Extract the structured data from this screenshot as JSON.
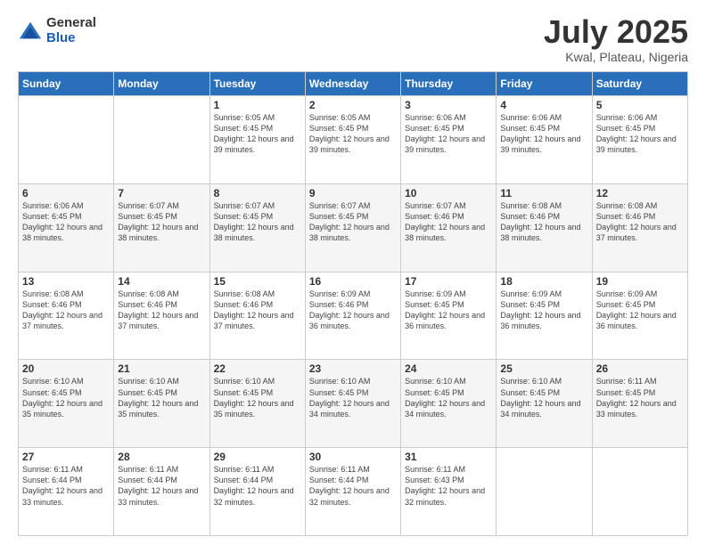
{
  "logo": {
    "general": "General",
    "blue": "Blue"
  },
  "header": {
    "month": "July 2025",
    "location": "Kwal, Plateau, Nigeria"
  },
  "days_of_week": [
    "Sunday",
    "Monday",
    "Tuesday",
    "Wednesday",
    "Thursday",
    "Friday",
    "Saturday"
  ],
  "weeks": [
    [
      {
        "day": "",
        "sunrise": "",
        "sunset": "",
        "daylight": ""
      },
      {
        "day": "",
        "sunrise": "",
        "sunset": "",
        "daylight": ""
      },
      {
        "day": "1",
        "sunrise": "Sunrise: 6:05 AM",
        "sunset": "Sunset: 6:45 PM",
        "daylight": "Daylight: 12 hours and 39 minutes."
      },
      {
        "day": "2",
        "sunrise": "Sunrise: 6:05 AM",
        "sunset": "Sunset: 6:45 PM",
        "daylight": "Daylight: 12 hours and 39 minutes."
      },
      {
        "day": "3",
        "sunrise": "Sunrise: 6:06 AM",
        "sunset": "Sunset: 6:45 PM",
        "daylight": "Daylight: 12 hours and 39 minutes."
      },
      {
        "day": "4",
        "sunrise": "Sunrise: 6:06 AM",
        "sunset": "Sunset: 6:45 PM",
        "daylight": "Daylight: 12 hours and 39 minutes."
      },
      {
        "day": "5",
        "sunrise": "Sunrise: 6:06 AM",
        "sunset": "Sunset: 6:45 PM",
        "daylight": "Daylight: 12 hours and 39 minutes."
      }
    ],
    [
      {
        "day": "6",
        "sunrise": "Sunrise: 6:06 AM",
        "sunset": "Sunset: 6:45 PM",
        "daylight": "Daylight: 12 hours and 38 minutes."
      },
      {
        "day": "7",
        "sunrise": "Sunrise: 6:07 AM",
        "sunset": "Sunset: 6:45 PM",
        "daylight": "Daylight: 12 hours and 38 minutes."
      },
      {
        "day": "8",
        "sunrise": "Sunrise: 6:07 AM",
        "sunset": "Sunset: 6:45 PM",
        "daylight": "Daylight: 12 hours and 38 minutes."
      },
      {
        "day": "9",
        "sunrise": "Sunrise: 6:07 AM",
        "sunset": "Sunset: 6:45 PM",
        "daylight": "Daylight: 12 hours and 38 minutes."
      },
      {
        "day": "10",
        "sunrise": "Sunrise: 6:07 AM",
        "sunset": "Sunset: 6:46 PM",
        "daylight": "Daylight: 12 hours and 38 minutes."
      },
      {
        "day": "11",
        "sunrise": "Sunrise: 6:08 AM",
        "sunset": "Sunset: 6:46 PM",
        "daylight": "Daylight: 12 hours and 38 minutes."
      },
      {
        "day": "12",
        "sunrise": "Sunrise: 6:08 AM",
        "sunset": "Sunset: 6:46 PM",
        "daylight": "Daylight: 12 hours and 37 minutes."
      }
    ],
    [
      {
        "day": "13",
        "sunrise": "Sunrise: 6:08 AM",
        "sunset": "Sunset: 6:46 PM",
        "daylight": "Daylight: 12 hours and 37 minutes."
      },
      {
        "day": "14",
        "sunrise": "Sunrise: 6:08 AM",
        "sunset": "Sunset: 6:46 PM",
        "daylight": "Daylight: 12 hours and 37 minutes."
      },
      {
        "day": "15",
        "sunrise": "Sunrise: 6:08 AM",
        "sunset": "Sunset: 6:46 PM",
        "daylight": "Daylight: 12 hours and 37 minutes."
      },
      {
        "day": "16",
        "sunrise": "Sunrise: 6:09 AM",
        "sunset": "Sunset: 6:46 PM",
        "daylight": "Daylight: 12 hours and 36 minutes."
      },
      {
        "day": "17",
        "sunrise": "Sunrise: 6:09 AM",
        "sunset": "Sunset: 6:45 PM",
        "daylight": "Daylight: 12 hours and 36 minutes."
      },
      {
        "day": "18",
        "sunrise": "Sunrise: 6:09 AM",
        "sunset": "Sunset: 6:45 PM",
        "daylight": "Daylight: 12 hours and 36 minutes."
      },
      {
        "day": "19",
        "sunrise": "Sunrise: 6:09 AM",
        "sunset": "Sunset: 6:45 PM",
        "daylight": "Daylight: 12 hours and 36 minutes."
      }
    ],
    [
      {
        "day": "20",
        "sunrise": "Sunrise: 6:10 AM",
        "sunset": "Sunset: 6:45 PM",
        "daylight": "Daylight: 12 hours and 35 minutes."
      },
      {
        "day": "21",
        "sunrise": "Sunrise: 6:10 AM",
        "sunset": "Sunset: 6:45 PM",
        "daylight": "Daylight: 12 hours and 35 minutes."
      },
      {
        "day": "22",
        "sunrise": "Sunrise: 6:10 AM",
        "sunset": "Sunset: 6:45 PM",
        "daylight": "Daylight: 12 hours and 35 minutes."
      },
      {
        "day": "23",
        "sunrise": "Sunrise: 6:10 AM",
        "sunset": "Sunset: 6:45 PM",
        "daylight": "Daylight: 12 hours and 34 minutes."
      },
      {
        "day": "24",
        "sunrise": "Sunrise: 6:10 AM",
        "sunset": "Sunset: 6:45 PM",
        "daylight": "Daylight: 12 hours and 34 minutes."
      },
      {
        "day": "25",
        "sunrise": "Sunrise: 6:10 AM",
        "sunset": "Sunset: 6:45 PM",
        "daylight": "Daylight: 12 hours and 34 minutes."
      },
      {
        "day": "26",
        "sunrise": "Sunrise: 6:11 AM",
        "sunset": "Sunset: 6:45 PM",
        "daylight": "Daylight: 12 hours and 33 minutes."
      }
    ],
    [
      {
        "day": "27",
        "sunrise": "Sunrise: 6:11 AM",
        "sunset": "Sunset: 6:44 PM",
        "daylight": "Daylight: 12 hours and 33 minutes."
      },
      {
        "day": "28",
        "sunrise": "Sunrise: 6:11 AM",
        "sunset": "Sunset: 6:44 PM",
        "daylight": "Daylight: 12 hours and 33 minutes."
      },
      {
        "day": "29",
        "sunrise": "Sunrise: 6:11 AM",
        "sunset": "Sunset: 6:44 PM",
        "daylight": "Daylight: 12 hours and 32 minutes."
      },
      {
        "day": "30",
        "sunrise": "Sunrise: 6:11 AM",
        "sunset": "Sunset: 6:44 PM",
        "daylight": "Daylight: 12 hours and 32 minutes."
      },
      {
        "day": "31",
        "sunrise": "Sunrise: 6:11 AM",
        "sunset": "Sunset: 6:43 PM",
        "daylight": "Daylight: 12 hours and 32 minutes."
      },
      {
        "day": "",
        "sunrise": "",
        "sunset": "",
        "daylight": ""
      },
      {
        "day": "",
        "sunrise": "",
        "sunset": "",
        "daylight": ""
      }
    ]
  ]
}
